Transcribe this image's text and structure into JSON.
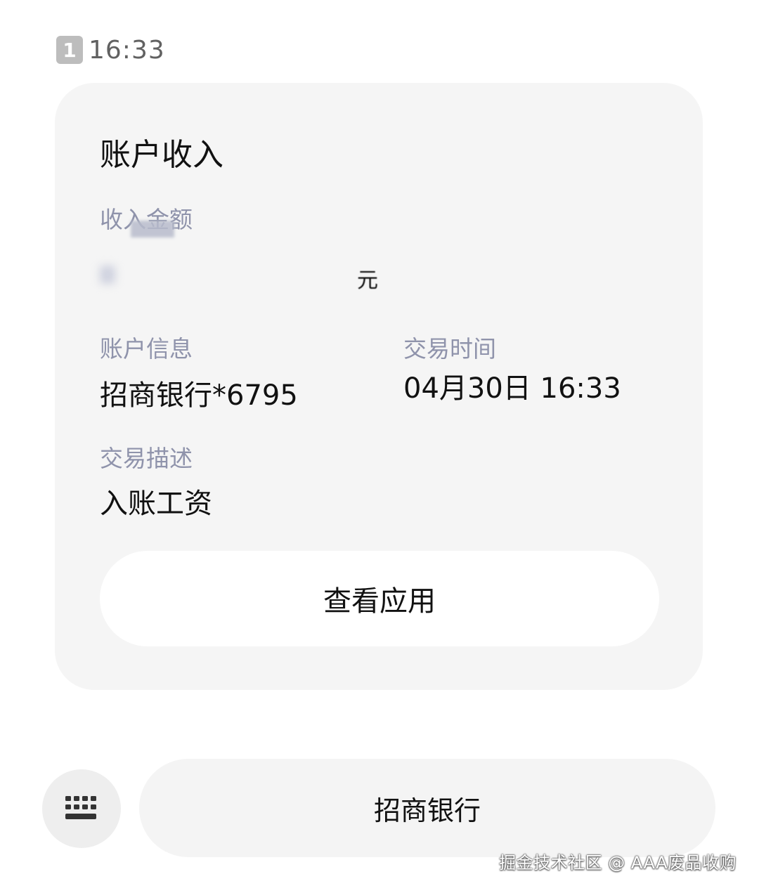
{
  "status": {
    "sim_badge": "1",
    "time": "16:33"
  },
  "card": {
    "title": "账户收入",
    "amount_label": "收入金额",
    "amount_unit": "元",
    "account_label": "账户信息",
    "account_value": "招商银行*6795",
    "time_label": "交易时间",
    "time_value": "04月30日 16:33",
    "desc_label": "交易描述",
    "desc_value": "入账工资",
    "action_button": "查看应用"
  },
  "bottom": {
    "keyboard_icon": "keyboard-icon",
    "menu_button": "招商银行"
  },
  "watermark": "掘金技术社区 @ AAA废品收购",
  "colors": {
    "card_bg": "#f5f5f5",
    "label": "#8f93ab",
    "text": "#111111"
  }
}
